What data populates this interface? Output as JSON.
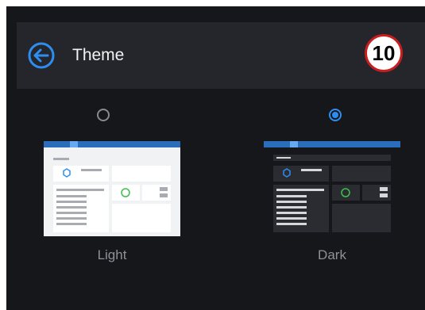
{
  "header": {
    "title": "Theme",
    "back_icon": "arrow-left-circle-icon",
    "step_number": "10"
  },
  "theme_options": [
    {
      "label": "Light",
      "selected": false
    },
    {
      "label": "Dark",
      "selected": true
    }
  ],
  "colors": {
    "background": "#16171b",
    "header": "#25262c",
    "accent": "#2d8ef0",
    "badge_border": "#c81e1e"
  }
}
